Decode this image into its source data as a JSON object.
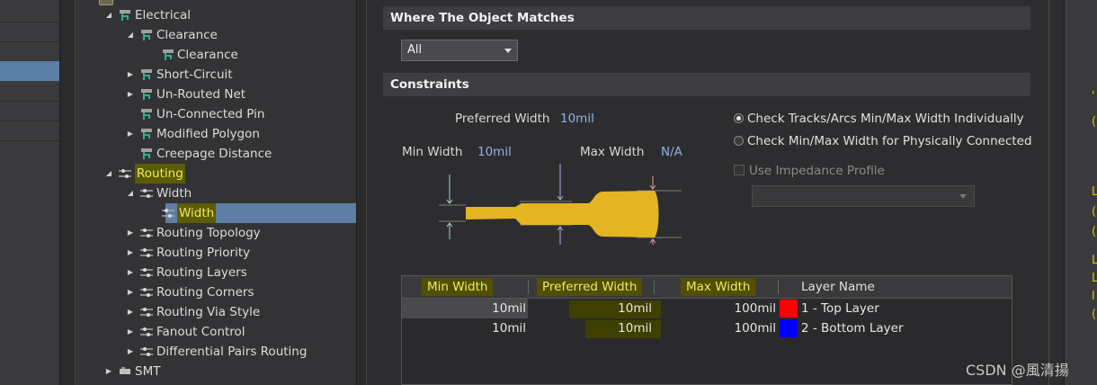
{
  "tree": {
    "items": [
      {
        "label": "Electrical",
        "level": 1,
        "expand": "open",
        "icon": "electrical-rule-icon"
      },
      {
        "label": "Clearance",
        "level": 2,
        "expand": "open",
        "icon": "electrical-rule-icon"
      },
      {
        "label": "Clearance",
        "level": 3,
        "expand": "none",
        "icon": "electrical-rule-icon"
      },
      {
        "label": "Short-Circuit",
        "level": 2,
        "expand": "closed",
        "icon": "electrical-rule-icon"
      },
      {
        "label": "Un-Routed Net",
        "level": 2,
        "expand": "closed",
        "icon": "electrical-rule-icon"
      },
      {
        "label": "Un-Connected Pin",
        "level": 2,
        "expand": "none",
        "icon": "electrical-rule-icon"
      },
      {
        "label": "Modified Polygon",
        "level": 2,
        "expand": "closed",
        "icon": "electrical-rule-icon"
      },
      {
        "label": "Creepage Distance",
        "level": 2,
        "expand": "none",
        "icon": "electrical-rule-icon"
      },
      {
        "label": "Routing",
        "level": 1,
        "expand": "open",
        "icon": "routing-rule-icon",
        "highlight": true
      },
      {
        "label": "Width",
        "level": 2,
        "expand": "open",
        "icon": "routing-rule-icon"
      },
      {
        "label": "Width",
        "level": 3,
        "expand": "none",
        "icon": "routing-rule-icon",
        "highlight": true,
        "selected": true
      },
      {
        "label": "Routing Topology",
        "level": 2,
        "expand": "closed",
        "icon": "routing-rule-icon"
      },
      {
        "label": "Routing Priority",
        "level": 2,
        "expand": "closed",
        "icon": "routing-rule-icon"
      },
      {
        "label": "Routing Layers",
        "level": 2,
        "expand": "closed",
        "icon": "routing-rule-icon"
      },
      {
        "label": "Routing Corners",
        "level": 2,
        "expand": "closed",
        "icon": "routing-rule-icon"
      },
      {
        "label": "Routing Via Style",
        "level": 2,
        "expand": "closed",
        "icon": "routing-rule-icon"
      },
      {
        "label": "Fanout Control",
        "level": 2,
        "expand": "closed",
        "icon": "routing-rule-icon"
      },
      {
        "label": "Differential Pairs Routing",
        "level": 2,
        "expand": "closed",
        "icon": "routing-rule-icon"
      },
      {
        "label": "SMT",
        "level": 1,
        "expand": "closed",
        "icon": "smt-rule-icon"
      }
    ]
  },
  "where_matches": {
    "header": "Where The Object Matches",
    "select_value": "All"
  },
  "constraints": {
    "header": "Constraints",
    "preferred_width_label": "Preferred Width",
    "preferred_width_value": "10mil",
    "min_width_label": "Min Width",
    "min_width_value": "10mil",
    "max_width_label": "Max Width",
    "max_width_value": "N/A",
    "option_individually": "Check Tracks/Arcs Min/Max Width Individually",
    "option_connected": "Check Min/Max Width for Physically Connected",
    "selected_option": "individually",
    "use_impedance_label": "Use Impedance Profile",
    "use_impedance_checked": false,
    "track_color": "#e5b422"
  },
  "layer_table": {
    "columns": {
      "min": "Min Width",
      "preferred": "Preferred Width",
      "max": "Max Width",
      "layer": "Layer Name"
    },
    "rows": [
      {
        "min": "10mil",
        "preferred": "10mil",
        "max": "100mil",
        "color": "#ff0000",
        "layer": "1 - Top Layer"
      },
      {
        "min": "10mil",
        "preferred": "10mil",
        "max": "100mil",
        "color": "#0000ff",
        "layer": "2 - Bottom Layer"
      }
    ]
  },
  "watermark": "CSDN @風清揚"
}
